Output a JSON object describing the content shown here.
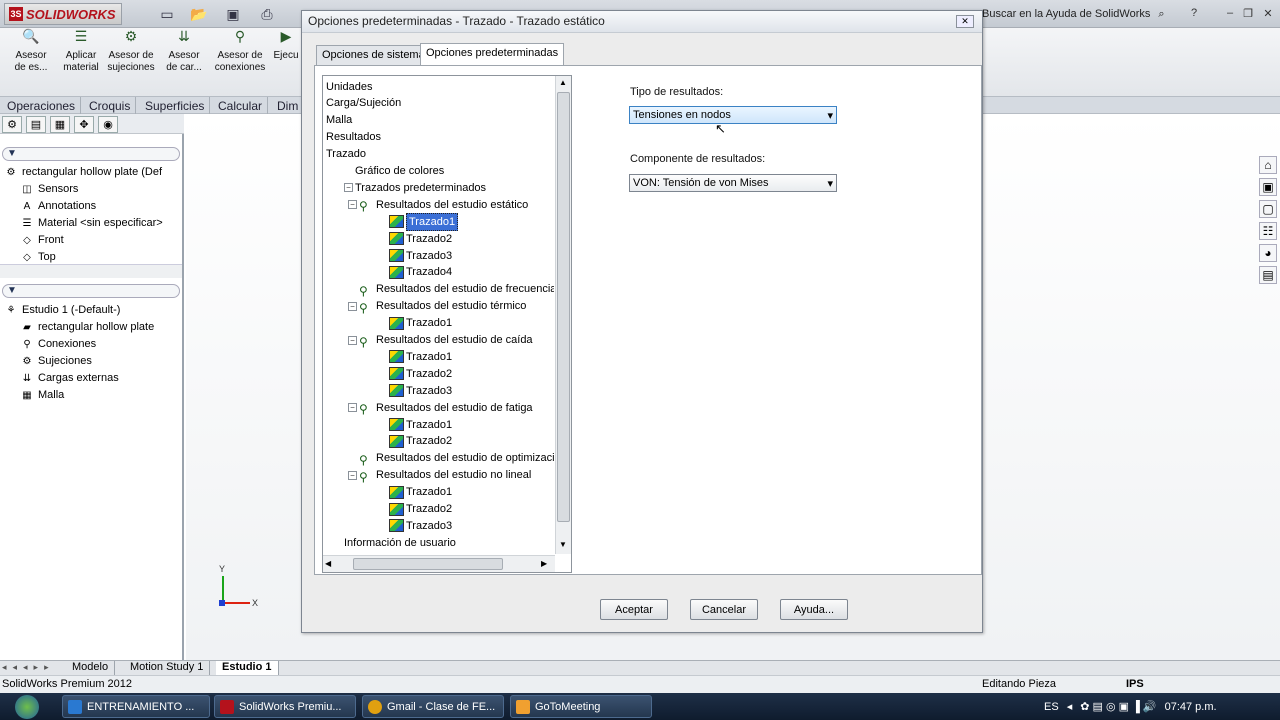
{
  "app": {
    "logo_text": "SOLIDWORKS",
    "search_placeholder": "Buscar en la Ayuda de SolidWorks"
  },
  "command_manager": {
    "buttons": [
      {
        "label": "Asesor de es...",
        "icon": "study-advisor-icon"
      },
      {
        "label": "Aplicar material",
        "icon": "apply-material-icon"
      },
      {
        "label": "Asesor de sujeciones",
        "icon": "fixtures-advisor-icon"
      },
      {
        "label": "Asesor de car...",
        "icon": "loads-advisor-icon"
      },
      {
        "label": "Asesor de conexiones",
        "icon": "connections-advisor-icon"
      },
      {
        "label": "Ejecu",
        "icon": "run-icon"
      }
    ],
    "tabs": [
      "Operaciones",
      "Croquis",
      "Superficies",
      "Calcular",
      "Dim"
    ]
  },
  "feature_tree": {
    "root": "rectangular hollow plate  (Def",
    "items": [
      "Sensors",
      "Annotations",
      "Material <sin especificar>",
      "Front",
      "Top"
    ]
  },
  "study_tree": {
    "root": "Estudio 1 (-Default-)",
    "items": [
      "rectangular hollow plate",
      "Conexiones",
      "Sujeciones",
      "Cargas externas",
      "Malla"
    ]
  },
  "dialog": {
    "title": "Opciones predeterminadas - Trazado - Trazado estático",
    "tabs": [
      "Opciones de sistema",
      "Opciones predeterminadas"
    ],
    "tree": {
      "top": [
        "Unidades",
        "Carga/Sujeción",
        "Malla",
        "Resultados",
        "Trazado"
      ],
      "color_chart": "Gráfico de colores",
      "default_plots": "Trazados predeterminados",
      "groups": [
        {
          "label": "Resultados del estudio estático",
          "plots": [
            "Trazado1",
            "Trazado2",
            "Trazado3",
            "Trazado4"
          ]
        },
        {
          "label": "Resultados del estudio de frecuencia",
          "plots": []
        },
        {
          "label": "Resultados del estudio térmico",
          "plots": [
            "Trazado1"
          ]
        },
        {
          "label": "Resultados del estudio de caída",
          "plots": [
            "Trazado1",
            "Trazado2",
            "Trazado3"
          ]
        },
        {
          "label": "Resultados del estudio de fatiga",
          "plots": [
            "Trazado1",
            "Trazado2"
          ]
        },
        {
          "label": "Resultados del estudio de optimización",
          "plots": []
        },
        {
          "label": "Resultados del estudio no lineal",
          "plots": [
            "Trazado1",
            "Trazado2",
            "Trazado3"
          ]
        }
      ],
      "user_info": "Información de usuario",
      "selected": "Trazado1"
    },
    "result_type_label": "Tipo de resultados:",
    "result_type_value": "Tensiones en nodos",
    "component_label": "Componente de resultados:",
    "component_value": "VON: Tensión de von Mises",
    "buttons": {
      "ok": "Aceptar",
      "cancel": "Cancelar",
      "help": "Ayuda..."
    }
  },
  "bottom_tabs": [
    "Modelo",
    "Motion Study 1",
    "Estudio 1"
  ],
  "status": {
    "left": "SolidWorks Premium 2012",
    "mode": "Editando Pieza",
    "units": "IPS"
  },
  "triad": {
    "x": "X",
    "y": "Y"
  },
  "taskbar": {
    "items": [
      "ENTRENAMIENTO ...",
      "SolidWorks Premiu...",
      "Gmail - Clase de FE...",
      "GoToMeeting"
    ],
    "lang": "ES",
    "time": "07:47 p.m."
  },
  "colors": {
    "accent": "#3b6fd6",
    "brand": "#b4121c"
  }
}
